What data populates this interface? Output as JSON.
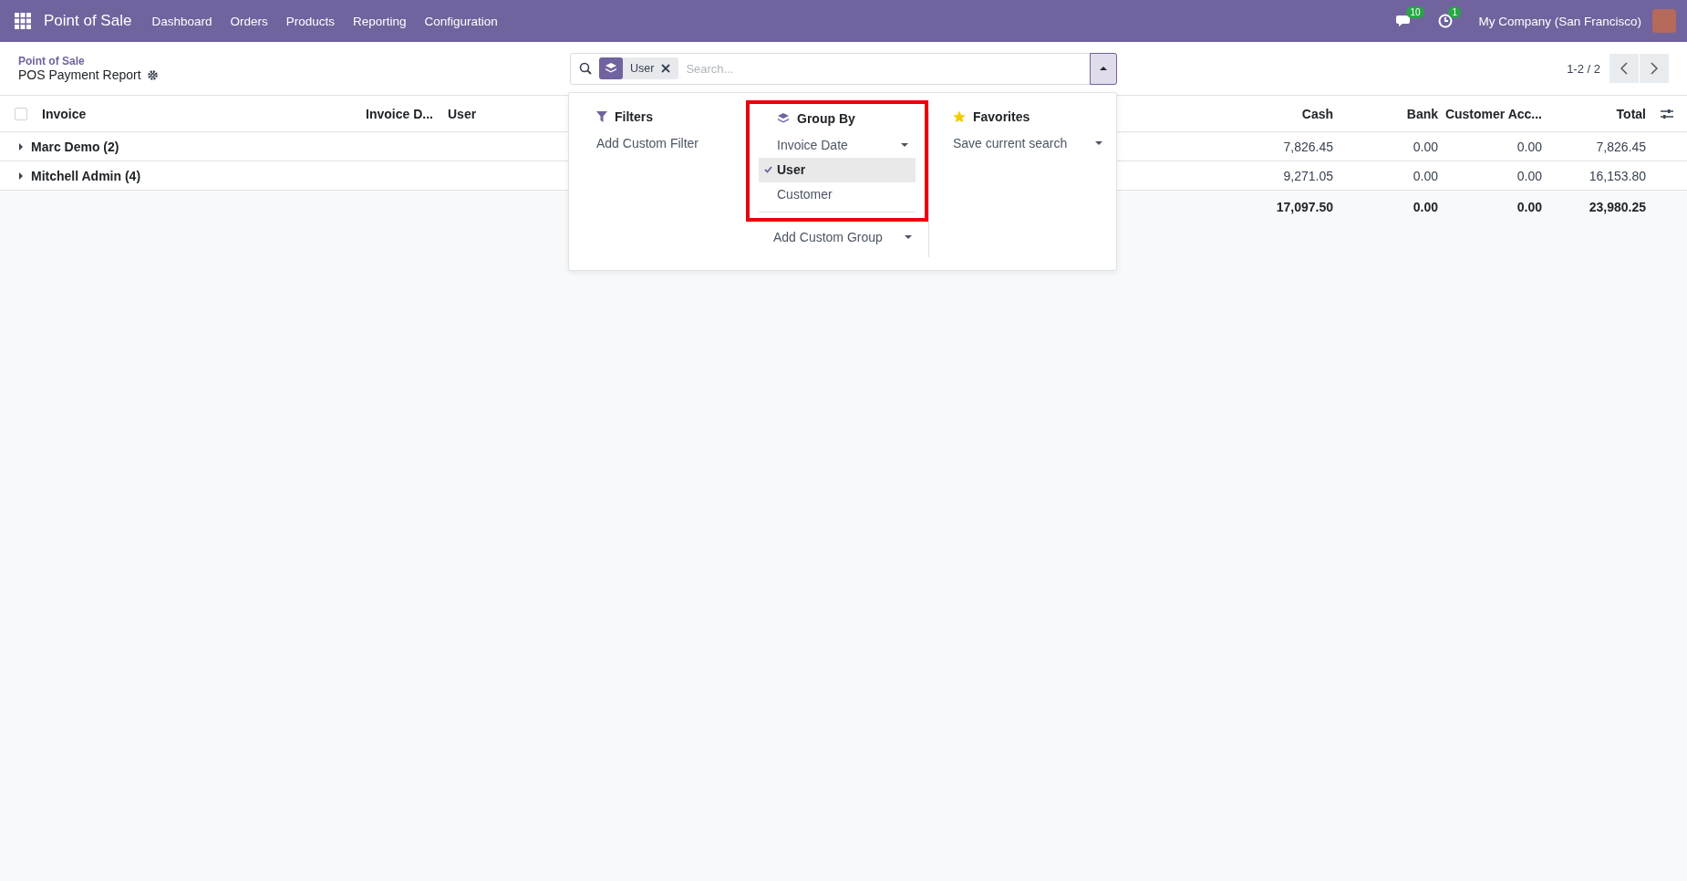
{
  "navbar": {
    "app": "Point of Sale",
    "menu": [
      "Dashboard",
      "Orders",
      "Products",
      "Reporting",
      "Configuration"
    ],
    "messages_badge": "10",
    "activity_badge": "1",
    "company": "My Company (San Francisco)"
  },
  "breadcrumb": {
    "parent": "Point of Sale",
    "current": "POS Payment Report"
  },
  "search": {
    "facet": "User",
    "placeholder": "Search...",
    "expanded": true
  },
  "pager": {
    "range": "1-2 / 2"
  },
  "dropdown": {
    "filters": {
      "title": "Filters",
      "items": [
        "Add Custom Filter"
      ]
    },
    "group_by": {
      "title": "Group By",
      "highlighted": true,
      "items": [
        {
          "label": "Invoice Date",
          "selected": false,
          "expandable": true
        },
        {
          "label": "User",
          "selected": true,
          "expandable": false
        },
        {
          "label": "Customer",
          "selected": false,
          "expandable": false
        }
      ],
      "custom": "Add Custom Group"
    },
    "favorites": {
      "title": "Favorites",
      "items": [
        "Save current search"
      ]
    }
  },
  "table": {
    "select_all": {
      "checked": false
    },
    "columns": [
      "Invoice",
      "Invoice D...",
      "User",
      "Cash",
      "Bank",
      "Customer Acc...",
      "Total"
    ],
    "groups": [
      {
        "name": "Marc Demo (2)",
        "expanded": false,
        "cash": "7,826.45",
        "bank": "0.00",
        "customer_account": "0.00",
        "total": "7,826.45"
      },
      {
        "name": "Mitchell Admin (4)",
        "expanded": false,
        "cash": "9,271.05",
        "bank": "0.00",
        "customer_account": "0.00",
        "total": "16,153.80"
      }
    ],
    "totals": {
      "cash": "17,097.50",
      "bank": "0.00",
      "customer_account": "0.00",
      "total": "23,980.25"
    }
  }
}
